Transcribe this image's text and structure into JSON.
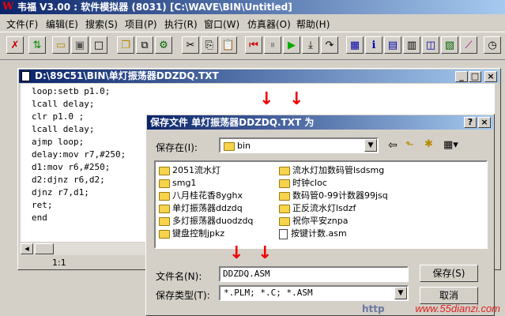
{
  "app": {
    "title": "韦福 V3.00 : 软件模拟器 (8031) [C:\\WAVE\\BIN\\Untitled]",
    "logo": "W"
  },
  "menu": [
    "文件(F)",
    "编辑(E)",
    "搜索(S)",
    "项目(P)",
    "执行(R)",
    "窗口(W)",
    "仿真器(O)",
    "帮助(H)"
  ],
  "editor": {
    "title": "D:\\89C51\\BIN\\单灯振荡器DDZDQ.TXT",
    "lines": [
      "loop:setb p1.0;",
      "lcall delay;",
      "clr p1.0 ;",
      "lcall delay;",
      "ajmp loop;",
      "delay:mov r7,#250;",
      "d1:mov r6,#250;",
      "d2:djnz r6,d2;",
      "djnz r7,d1;",
      "ret;",
      "end"
    ],
    "status_position": "1:1"
  },
  "dialog": {
    "title": "保存文件 单灯振荡器DDZDQ.TXT 为",
    "save_in_label": "保存在(I):",
    "save_in_value": "bin",
    "files_left": [
      "2051流水灯",
      "smg1",
      "八月桂花香8yghx",
      "单灯振荡器ddzdq",
      "多灯振荡器duodzdq",
      "键盘控制jpkz"
    ],
    "files_right": [
      "流水灯加数码管lsdsmg",
      "时钟cloc",
      "数码管0-99计数器99jsq",
      "正反流水灯lsdzf",
      "祝你平安znpa",
      "按键计数.asm"
    ],
    "filename_label": "文件名(N):",
    "filename_value": "DDZDQ.ASM",
    "filetype_label": "保存类型(T):",
    "filetype_value": "*.PLM; *.C; *.ASM",
    "save_button": "保存(S)",
    "cancel_button": "取消",
    "help_button": "?",
    "close_button": "×"
  },
  "watermark": "www.55dianzi.com",
  "watermark_prefix": "http"
}
